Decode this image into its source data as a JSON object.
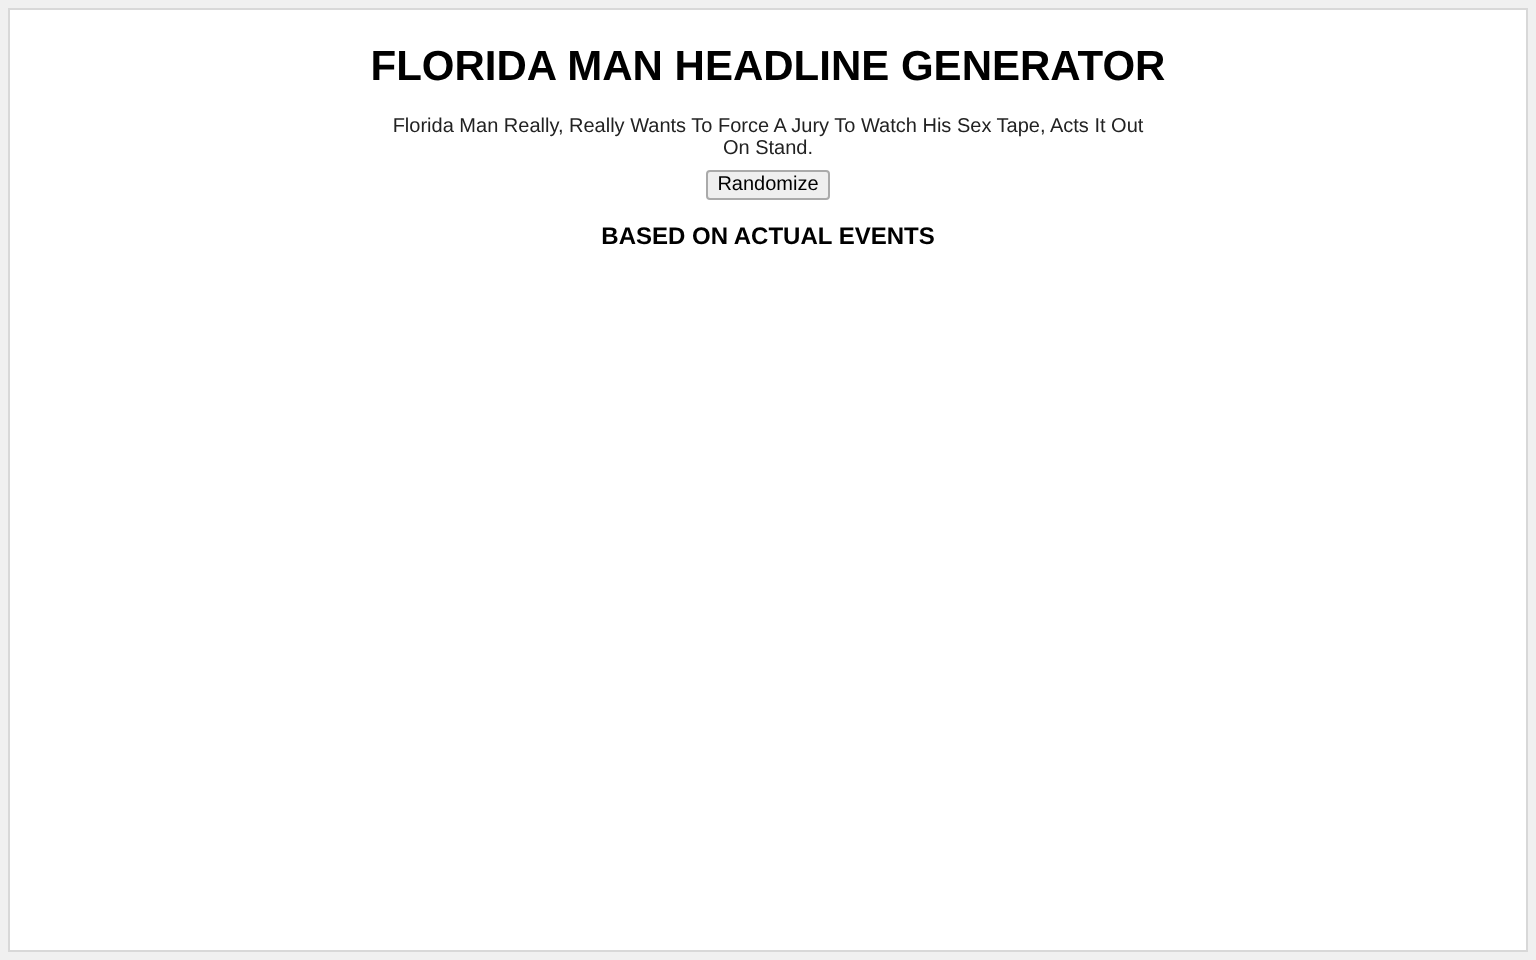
{
  "title": "FLORIDA MAN HEADLINE GENERATOR",
  "headline": "Florida Man Really, Really Wants To Force A Jury To Watch His Sex Tape, Acts It Out On Stand.",
  "button": "Randomize",
  "footer": "BASED ON ACTUAL EVENTS"
}
